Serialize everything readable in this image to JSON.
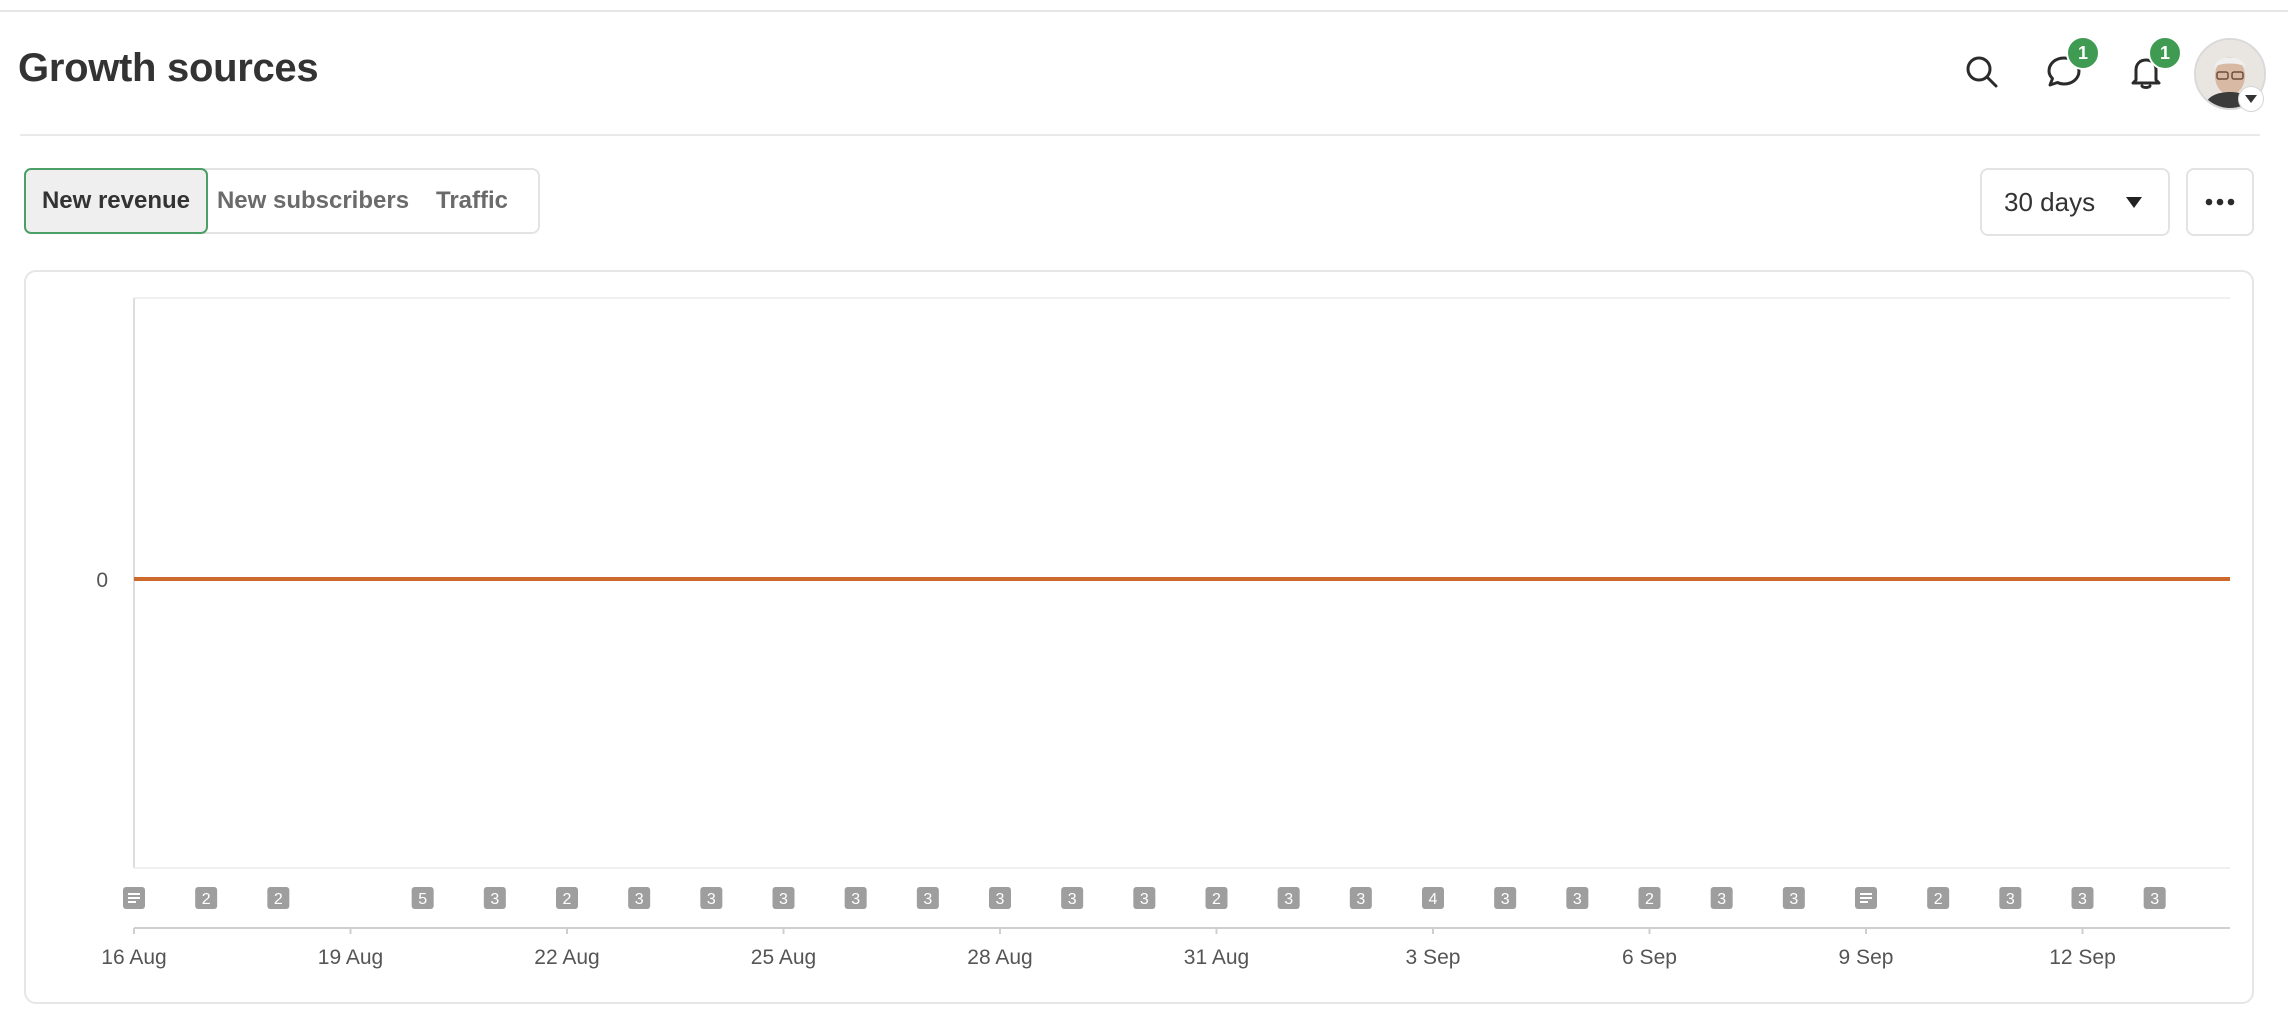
{
  "page": {
    "title": "Growth sources"
  },
  "header": {
    "search_icon": "search-icon",
    "messages_badge": "1",
    "notifications_badge": "1"
  },
  "tabs": [
    {
      "label": "New revenue",
      "active": true
    },
    {
      "label": "New subscribers",
      "active": false
    },
    {
      "label": "Traffic",
      "active": false
    }
  ],
  "range": {
    "label": "30 days"
  },
  "colors": {
    "accent_green": "#3f9a52",
    "series_line": "#cc6a2e",
    "marker_gray": "#9e9e9e"
  },
  "chart_data": {
    "type": "line",
    "title": "",
    "xlabel": "",
    "ylabel": "",
    "x_tick_labels": [
      "16 Aug",
      "19 Aug",
      "22 Aug",
      "25 Aug",
      "28 Aug",
      "31 Aug",
      "3 Sep",
      "6 Sep",
      "9 Sep",
      "12 Sep"
    ],
    "y_tick_labels": [
      "0"
    ],
    "x": [
      "16 Aug",
      "17 Aug",
      "18 Aug",
      "19 Aug",
      "20 Aug",
      "21 Aug",
      "22 Aug",
      "23 Aug",
      "24 Aug",
      "25 Aug",
      "26 Aug",
      "27 Aug",
      "28 Aug",
      "29 Aug",
      "30 Aug",
      "31 Aug",
      "1 Sep",
      "2 Sep",
      "3 Sep",
      "4 Sep",
      "5 Sep",
      "6 Sep",
      "7 Sep",
      "8 Sep",
      "9 Sep",
      "10 Sep",
      "11 Sep",
      "12 Sep",
      "13 Sep",
      "14 Sep"
    ],
    "series": [
      {
        "color": "#cc6a2e",
        "values": [
          0,
          0,
          0,
          0,
          0,
          0,
          0,
          0,
          0,
          0,
          0,
          0,
          0,
          0,
          0,
          0,
          0,
          0,
          0,
          0,
          0,
          0,
          0,
          0,
          0,
          0,
          0,
          0,
          0,
          0
        ]
      }
    ],
    "grid": false,
    "event_markers": [
      {
        "date": "16 Aug",
        "label": "",
        "icon": "post-icon"
      },
      {
        "date": "17 Aug",
        "label": "2"
      },
      {
        "date": "18 Aug",
        "label": "2"
      },
      {
        "date": "20 Aug",
        "label": "5"
      },
      {
        "date": "21 Aug",
        "label": "3"
      },
      {
        "date": "22 Aug",
        "label": "2"
      },
      {
        "date": "23 Aug",
        "label": "3"
      },
      {
        "date": "24 Aug",
        "label": "3"
      },
      {
        "date": "25 Aug",
        "label": "3"
      },
      {
        "date": "26 Aug",
        "label": "3"
      },
      {
        "date": "27 Aug",
        "label": "3"
      },
      {
        "date": "28 Aug",
        "label": "3"
      },
      {
        "date": "29 Aug",
        "label": "3"
      },
      {
        "date": "30 Aug",
        "label": "3"
      },
      {
        "date": "31 Aug",
        "label": "2"
      },
      {
        "date": "1 Sep",
        "label": "3"
      },
      {
        "date": "2 Sep",
        "label": "3"
      },
      {
        "date": "3 Sep",
        "label": "4"
      },
      {
        "date": "4 Sep",
        "label": "3"
      },
      {
        "date": "5 Sep",
        "label": "3"
      },
      {
        "date": "6 Sep",
        "label": "2"
      },
      {
        "date": "7 Sep",
        "label": "3"
      },
      {
        "date": "8 Sep",
        "label": "3"
      },
      {
        "date": "9 Sep",
        "label": "",
        "icon": "post-icon"
      },
      {
        "date": "10 Sep",
        "label": "2"
      },
      {
        "date": "11 Sep",
        "label": "3"
      },
      {
        "date": "12 Sep",
        "label": "3"
      },
      {
        "date": "13 Sep",
        "label": "3"
      }
    ]
  }
}
